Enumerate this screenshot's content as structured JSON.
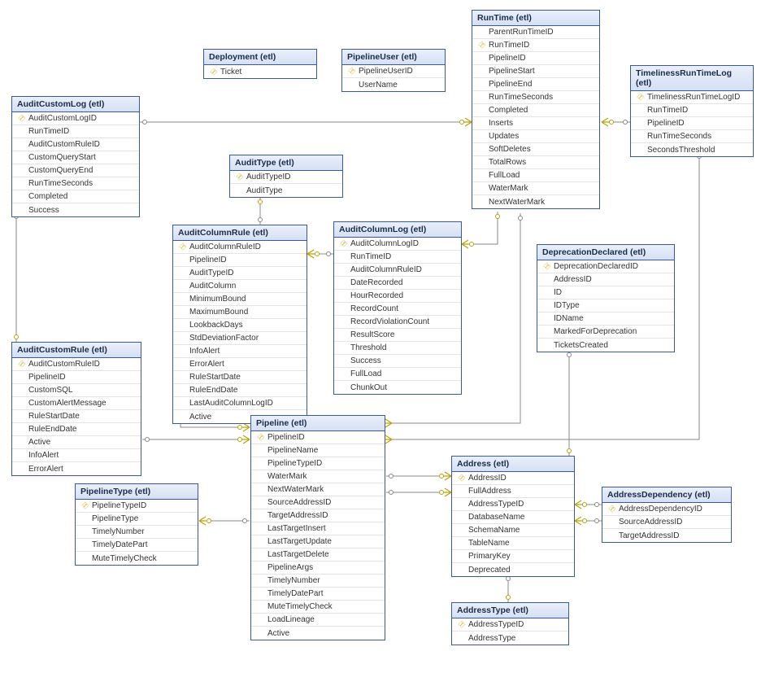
{
  "tables": {
    "deployment": {
      "title": "Deployment (etl)",
      "cols": [
        {
          "k": true,
          "n": "Ticket"
        }
      ]
    },
    "pipelineUser": {
      "title": "PipelineUser (etl)",
      "cols": [
        {
          "k": true,
          "n": "PipelineUserID"
        },
        {
          "k": false,
          "n": "UserName"
        }
      ]
    },
    "runtime": {
      "title": "RunTime (etl)",
      "cols": [
        {
          "k": false,
          "n": "ParentRunTimeID"
        },
        {
          "k": true,
          "n": "RunTimeID"
        },
        {
          "k": false,
          "n": "PipelineID"
        },
        {
          "k": false,
          "n": "PipelineStart"
        },
        {
          "k": false,
          "n": "PipelineEnd"
        },
        {
          "k": false,
          "n": "RunTimeSeconds"
        },
        {
          "k": false,
          "n": "Completed"
        },
        {
          "k": false,
          "n": "Inserts"
        },
        {
          "k": false,
          "n": "Updates"
        },
        {
          "k": false,
          "n": "SoftDeletes"
        },
        {
          "k": false,
          "n": "TotalRows"
        },
        {
          "k": false,
          "n": "FullLoad"
        },
        {
          "k": false,
          "n": "WaterMark"
        },
        {
          "k": false,
          "n": "NextWaterMark"
        }
      ]
    },
    "timeliness": {
      "title": "TimelinessRunTimeLog (etl)",
      "cols": [
        {
          "k": true,
          "n": "TimelinessRunTimeLogID"
        },
        {
          "k": false,
          "n": "RunTimeID"
        },
        {
          "k": false,
          "n": "PipelineID"
        },
        {
          "k": false,
          "n": "RunTimeSeconds"
        },
        {
          "k": false,
          "n": "SecondsThreshold"
        }
      ]
    },
    "auditCustomLog": {
      "title": "AuditCustomLog (etl)",
      "cols": [
        {
          "k": true,
          "n": "AuditCustomLogID"
        },
        {
          "k": false,
          "n": "RunTimeID"
        },
        {
          "k": false,
          "n": "AuditCustomRuleID"
        },
        {
          "k": false,
          "n": "CustomQueryStart"
        },
        {
          "k": false,
          "n": "CustomQueryEnd"
        },
        {
          "k": false,
          "n": "RunTimeSeconds"
        },
        {
          "k": false,
          "n": "Completed"
        },
        {
          "k": false,
          "n": "Success"
        }
      ]
    },
    "auditType": {
      "title": "AuditType (etl)",
      "cols": [
        {
          "k": true,
          "n": "AuditTypeID"
        },
        {
          "k": false,
          "n": "AuditType"
        }
      ]
    },
    "auditColumnRule": {
      "title": "AuditColumnRule (etl)",
      "cols": [
        {
          "k": true,
          "n": "AuditColumnRuleID"
        },
        {
          "k": false,
          "n": "PipelineID"
        },
        {
          "k": false,
          "n": "AuditTypeID"
        },
        {
          "k": false,
          "n": "AuditColumn"
        },
        {
          "k": false,
          "n": "MinimumBound"
        },
        {
          "k": false,
          "n": "MaximumBound"
        },
        {
          "k": false,
          "n": "LookbackDays"
        },
        {
          "k": false,
          "n": "StdDeviationFactor"
        },
        {
          "k": false,
          "n": "InfoAlert"
        },
        {
          "k": false,
          "n": "ErrorAlert"
        },
        {
          "k": false,
          "n": "RuleStartDate"
        },
        {
          "k": false,
          "n": "RuleEndDate"
        },
        {
          "k": false,
          "n": "LastAuditColumnLogID"
        },
        {
          "k": false,
          "n": "Active"
        }
      ]
    },
    "auditColumnLog": {
      "title": "AuditColumnLog (etl)",
      "cols": [
        {
          "k": true,
          "n": "AuditColumnLogID"
        },
        {
          "k": false,
          "n": "RunTimeID"
        },
        {
          "k": false,
          "n": "AuditColumnRuleID"
        },
        {
          "k": false,
          "n": "DateRecorded"
        },
        {
          "k": false,
          "n": "HourRecorded"
        },
        {
          "k": false,
          "n": "RecordCount"
        },
        {
          "k": false,
          "n": "RecordViolationCount"
        },
        {
          "k": false,
          "n": "ResultScore"
        },
        {
          "k": false,
          "n": "Threshold"
        },
        {
          "k": false,
          "n": "Success"
        },
        {
          "k": false,
          "n": "FullLoad"
        },
        {
          "k": false,
          "n": "ChunkOut"
        }
      ]
    },
    "deprecation": {
      "title": "DeprecationDeclared (etl)",
      "cols": [
        {
          "k": true,
          "n": "DeprecationDeclaredID"
        },
        {
          "k": false,
          "n": "AddressID"
        },
        {
          "k": false,
          "n": "ID"
        },
        {
          "k": false,
          "n": "IDType"
        },
        {
          "k": false,
          "n": "IDName"
        },
        {
          "k": false,
          "n": "MarkedForDeprecation"
        },
        {
          "k": false,
          "n": "TicketsCreated"
        }
      ]
    },
    "auditCustomRule": {
      "title": "AuditCustomRule (etl)",
      "cols": [
        {
          "k": true,
          "n": "AuditCustomRuleID"
        },
        {
          "k": false,
          "n": "PipelineID"
        },
        {
          "k": false,
          "n": "CustomSQL"
        },
        {
          "k": false,
          "n": "CustomAlertMessage"
        },
        {
          "k": false,
          "n": "RuleStartDate"
        },
        {
          "k": false,
          "n": "RuleEndDate"
        },
        {
          "k": false,
          "n": "Active"
        },
        {
          "k": false,
          "n": "InfoAlert"
        },
        {
          "k": false,
          "n": "ErrorAlert"
        }
      ]
    },
    "pipeline": {
      "title": "Pipeline (etl)",
      "cols": [
        {
          "k": true,
          "n": "PipelineID"
        },
        {
          "k": false,
          "n": "PipelineName"
        },
        {
          "k": false,
          "n": "PipelineTypeID"
        },
        {
          "k": false,
          "n": "WaterMark"
        },
        {
          "k": false,
          "n": "NextWaterMark"
        },
        {
          "k": false,
          "n": "SourceAddressID"
        },
        {
          "k": false,
          "n": "TargetAddressID"
        },
        {
          "k": false,
          "n": "LastTargetInsert"
        },
        {
          "k": false,
          "n": "LastTargetUpdate"
        },
        {
          "k": false,
          "n": "LastTargetDelete"
        },
        {
          "k": false,
          "n": "PipelineArgs"
        },
        {
          "k": false,
          "n": "TimelyNumber"
        },
        {
          "k": false,
          "n": "TimelyDatePart"
        },
        {
          "k": false,
          "n": "MuteTimelyCheck"
        },
        {
          "k": false,
          "n": "LoadLineage"
        },
        {
          "k": false,
          "n": "Active"
        }
      ]
    },
    "address": {
      "title": "Address (etl)",
      "cols": [
        {
          "k": true,
          "n": "AddressID"
        },
        {
          "k": false,
          "n": "FullAddress"
        },
        {
          "k": false,
          "n": "AddressTypeID"
        },
        {
          "k": false,
          "n": "DatabaseName"
        },
        {
          "k": false,
          "n": "SchemaName"
        },
        {
          "k": false,
          "n": "TableName"
        },
        {
          "k": false,
          "n": "PrimaryKey"
        },
        {
          "k": false,
          "n": "Deprecated"
        }
      ]
    },
    "addressDependency": {
      "title": "AddressDependency (etl)",
      "cols": [
        {
          "k": true,
          "n": "AddressDependencyID"
        },
        {
          "k": false,
          "n": "SourceAddressID"
        },
        {
          "k": false,
          "n": "TargetAddressID"
        }
      ]
    },
    "pipelineType": {
      "title": "PipelineType (etl)",
      "cols": [
        {
          "k": true,
          "n": "PipelineTypeID"
        },
        {
          "k": false,
          "n": "PipelineType"
        },
        {
          "k": false,
          "n": "TimelyNumber"
        },
        {
          "k": false,
          "n": "TimelyDatePart"
        },
        {
          "k": false,
          "n": "MuteTimelyCheck"
        }
      ]
    },
    "addressType": {
      "title": "AddressType (etl)",
      "cols": [
        {
          "k": true,
          "n": "AddressTypeID"
        },
        {
          "k": false,
          "n": "AddressType"
        }
      ]
    }
  }
}
